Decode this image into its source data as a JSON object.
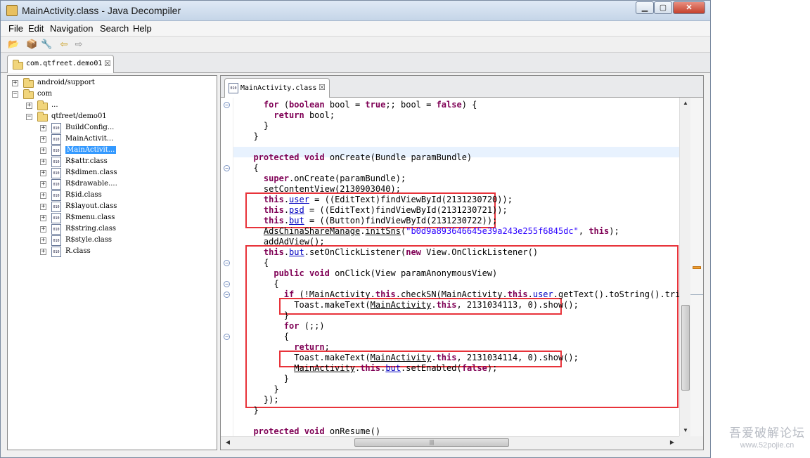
{
  "window": {
    "title": "MainActivity.class - Java Decompiler",
    "controls": {
      "minimize": "▁",
      "maximize": "▢",
      "close": "✕"
    }
  },
  "menubar": {
    "items": [
      "File",
      "Edit",
      "Navigation",
      "Search",
      "Help"
    ]
  },
  "toolbar": {
    "icons": [
      "open-file-icon",
      "open-type-icon",
      "search-icon",
      "back-arrow-icon",
      "forward-arrow-icon"
    ],
    "glyphs": [
      "📂",
      "📦",
      "🔧",
      "⇦",
      "⇨"
    ]
  },
  "outer_tab": {
    "label": "com.qtfreet.demo01",
    "close": "☒"
  },
  "tree": {
    "rows": [
      {
        "label": "android/support",
        "expander": "+",
        "icon": "folder"
      },
      {
        "label": "com",
        "expander": "−",
        "icon": "folder"
      },
      {
        "label": "...",
        "expander": "+",
        "icon": "folder"
      },
      {
        "label": "qtfreet/demo01",
        "expander": "−",
        "icon": "folder"
      },
      {
        "label": "BuildConfig...",
        "expander": "+",
        "icon": "class"
      },
      {
        "label": "MainActivit...",
        "expander": "+",
        "icon": "class"
      },
      {
        "label": "MainActivit...",
        "expander": "+",
        "icon": "class",
        "selected": true
      },
      {
        "label": "R$attr.class",
        "expander": "+",
        "icon": "class"
      },
      {
        "label": "R$dimen.class",
        "expander": "+",
        "icon": "class"
      },
      {
        "label": "R$drawable....",
        "expander": "+",
        "icon": "class"
      },
      {
        "label": "R$id.class",
        "expander": "+",
        "icon": "class"
      },
      {
        "label": "R$layout.class",
        "expander": "+",
        "icon": "class"
      },
      {
        "label": "R$menu.class",
        "expander": "+",
        "icon": "class"
      },
      {
        "label": "R$string.class",
        "expander": "+",
        "icon": "class"
      },
      {
        "label": "R$style.class",
        "expander": "+",
        "icon": "class"
      },
      {
        "label": "R.class",
        "expander": "+",
        "icon": "class"
      }
    ]
  },
  "editor_tab": {
    "label": "MainActivity.class",
    "close": "☒",
    "icon_text": "010"
  },
  "code_lines": [
    {
      "segs": [
        [
          "    ",
          ""
        ],
        [
          "for",
          "kw"
        ],
        [
          " (",
          ""
        ],
        [
          "boolean",
          "kw"
        ],
        [
          " bool = ",
          ""
        ],
        [
          "true",
          "kw"
        ],
        [
          ";; bool = ",
          ""
        ],
        [
          "false",
          "kw"
        ],
        [
          ") {",
          ""
        ]
      ]
    },
    {
      "segs": [
        [
          "      ",
          ""
        ],
        [
          "return",
          "kw"
        ],
        [
          " bool;",
          ""
        ]
      ]
    },
    {
      "segs": [
        [
          "    }",
          ""
        ]
      ]
    },
    {
      "segs": [
        [
          "  }",
          ""
        ]
      ]
    },
    {
      "segs": [
        [
          "",
          ""
        ]
      ]
    },
    {
      "segs": [
        [
          "  ",
          ""
        ],
        [
          "protected",
          "kw"
        ],
        [
          " ",
          ""
        ],
        [
          "void",
          "kw"
        ],
        [
          " onCreate(Bundle paramBundle)",
          ""
        ]
      ]
    },
    {
      "segs": [
        [
          "  {",
          ""
        ]
      ]
    },
    {
      "segs": [
        [
          "    ",
          ""
        ],
        [
          "super",
          "kw"
        ],
        [
          ".onCreate(paramBundle);",
          ""
        ]
      ]
    },
    {
      "segs": [
        [
          "    setContentView(2130903040);",
          ""
        ]
      ]
    },
    {
      "segs": [
        [
          "    ",
          ""
        ],
        [
          "this",
          "kw"
        ],
        [
          ".",
          ""
        ],
        [
          "user",
          "fld ul"
        ],
        [
          " = ((EditText)findViewById(2131230720));",
          ""
        ]
      ]
    },
    {
      "segs": [
        [
          "    ",
          ""
        ],
        [
          "this",
          "kw"
        ],
        [
          ".",
          ""
        ],
        [
          "psd",
          "fld ul"
        ],
        [
          " = ((EditText)findViewById(2131230721));",
          ""
        ]
      ]
    },
    {
      "segs": [
        [
          "    ",
          ""
        ],
        [
          "this",
          "kw"
        ],
        [
          ".",
          ""
        ],
        [
          "but",
          "fld ul"
        ],
        [
          " = ((Button)findViewById(2131230722));",
          ""
        ]
      ]
    },
    {
      "segs": [
        [
          "    ",
          ""
        ],
        [
          "AdsChinaShareManage",
          "ul"
        ],
        [
          ".",
          ""
        ],
        [
          "initSns",
          "ul"
        ],
        [
          "(",
          ""
        ],
        [
          "\"b0d9a893646645e39a243e255f6845dc\"",
          "str"
        ],
        [
          ", ",
          ""
        ],
        [
          "this",
          "kw"
        ],
        [
          ");",
          ""
        ]
      ]
    },
    {
      "segs": [
        [
          "    addAdView();",
          ""
        ]
      ]
    },
    {
      "segs": [
        [
          "    ",
          ""
        ],
        [
          "this",
          "kw"
        ],
        [
          ".",
          ""
        ],
        [
          "but",
          "fld ul"
        ],
        [
          ".setOnClickListener(",
          ""
        ],
        [
          "new",
          "kw"
        ],
        [
          " View.OnClickListener()",
          ""
        ]
      ]
    },
    {
      "segs": [
        [
          "    {",
          ""
        ]
      ]
    },
    {
      "segs": [
        [
          "      ",
          ""
        ],
        [
          "public",
          "kw"
        ],
        [
          " ",
          ""
        ],
        [
          "void",
          "kw"
        ],
        [
          " onClick(View paramAnonymousView)",
          ""
        ]
      ]
    },
    {
      "segs": [
        [
          "      {",
          ""
        ]
      ]
    },
    {
      "segs": [
        [
          "        ",
          ""
        ],
        [
          "if",
          "kw"
        ],
        [
          " (!MainActivity.",
          ""
        ],
        [
          "this",
          "kw"
        ],
        [
          ".checkSN(MainActivity.",
          ""
        ],
        [
          "this",
          "kw"
        ],
        [
          ".",
          ""
        ],
        [
          "user",
          "fld"
        ],
        [
          ".getText().toString().trim(),",
          ""
        ]
      ]
    },
    {
      "segs": [
        [
          "          Toast.makeText(",
          ""
        ],
        [
          "MainActivity",
          "ul"
        ],
        [
          ".",
          ""
        ],
        [
          "this",
          "kw"
        ],
        [
          ", 2131034113, 0).show();",
          ""
        ]
      ]
    },
    {
      "segs": [
        [
          "        }",
          ""
        ]
      ]
    },
    {
      "segs": [
        [
          "        ",
          ""
        ],
        [
          "for",
          "kw"
        ],
        [
          " (;;)",
          ""
        ]
      ]
    },
    {
      "segs": [
        [
          "        {",
          ""
        ]
      ]
    },
    {
      "segs": [
        [
          "          ",
          ""
        ],
        [
          "return",
          "kw"
        ],
        [
          ";",
          ""
        ]
      ]
    },
    {
      "segs": [
        [
          "          Toast.makeText(",
          ""
        ],
        [
          "MainActivity",
          "ul"
        ],
        [
          ".",
          ""
        ],
        [
          "this",
          "kw"
        ],
        [
          ", 2131034114, 0).show();",
          ""
        ]
      ]
    },
    {
      "segs": [
        [
          "          ",
          ""
        ],
        [
          "MainActivity",
          "ul"
        ],
        [
          ".",
          ""
        ],
        [
          "this",
          "kw"
        ],
        [
          ".",
          ""
        ],
        [
          "but",
          "fld ul"
        ],
        [
          ".setEnabled(",
          ""
        ],
        [
          "false",
          "kw"
        ],
        [
          ");",
          ""
        ]
      ]
    },
    {
      "segs": [
        [
          "        }",
          ""
        ]
      ]
    },
    {
      "segs": [
        [
          "      }",
          ""
        ]
      ]
    },
    {
      "segs": [
        [
          "    });",
          ""
        ]
      ]
    },
    {
      "segs": [
        [
          "  }",
          ""
        ]
      ]
    },
    {
      "segs": [
        [
          "",
          ""
        ]
      ]
    },
    {
      "segs": [
        [
          "  ",
          ""
        ],
        [
          "protected",
          "kw"
        ],
        [
          " ",
          ""
        ],
        [
          "void",
          "kw"
        ],
        [
          " onResume()",
          ""
        ]
      ]
    }
  ],
  "fold_markers": {
    "glyph": "−",
    "lines": [
      0,
      6,
      15,
      17,
      18,
      22
    ]
  },
  "scroll": {
    "up": "▲",
    "down": "▼",
    "left": "◀",
    "right": "▶",
    "grip": "|||"
  },
  "watermark": {
    "text": "吾爱破解论坛",
    "url": "www.52pojie.cn"
  }
}
